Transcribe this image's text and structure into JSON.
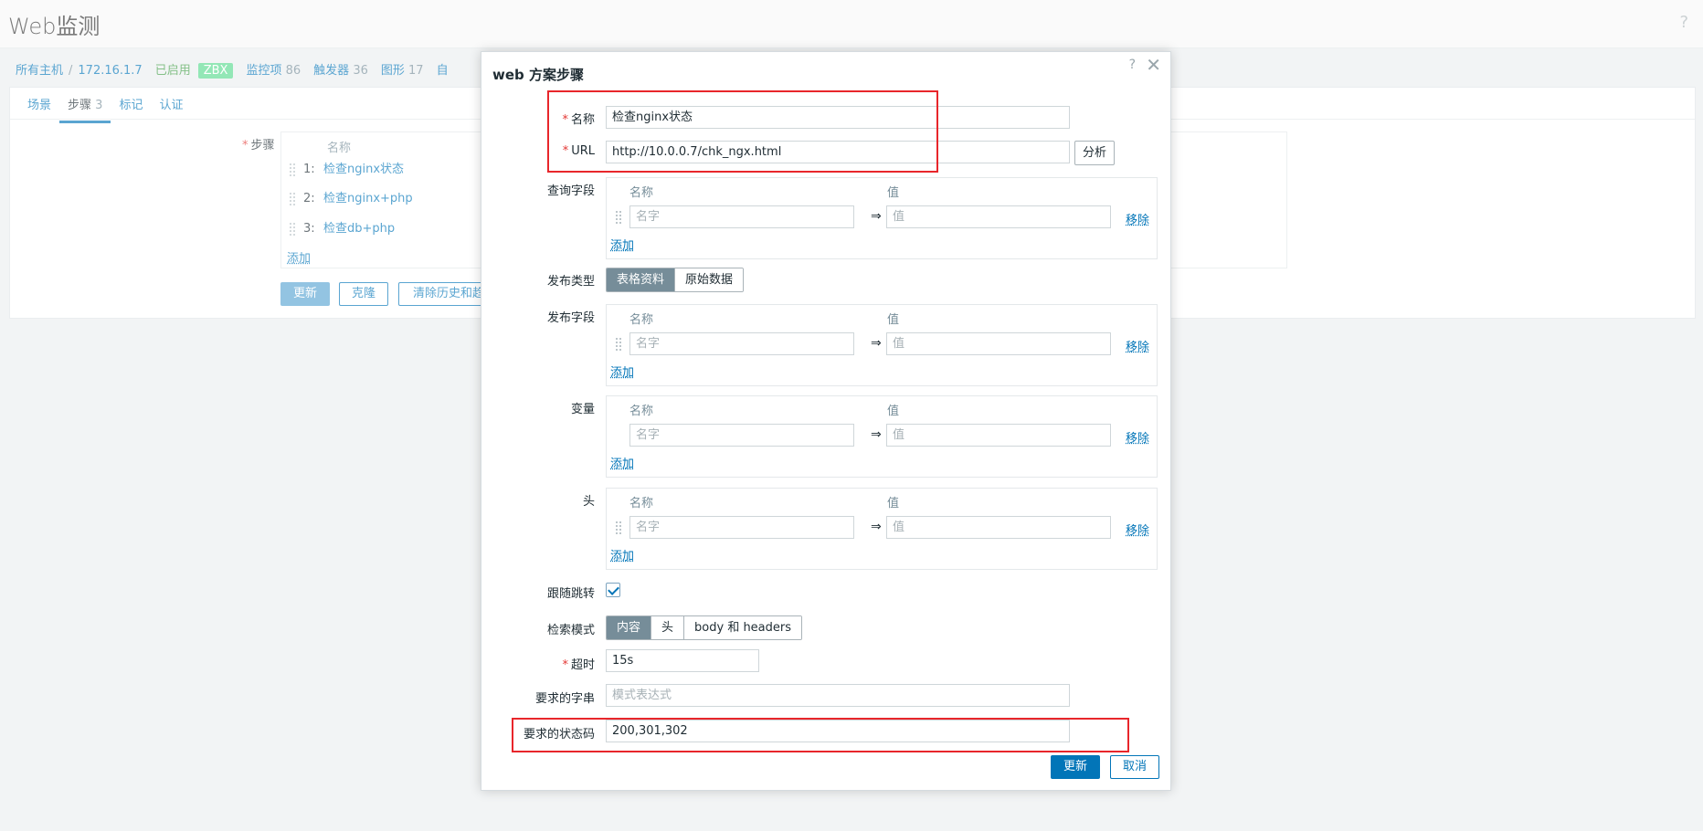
{
  "page": {
    "title": "Web监测",
    "help": "?"
  },
  "breadcrumb": {
    "all_hosts": "所有主机",
    "separator": "/",
    "host": "172.16.1.7",
    "status": "已启用",
    "zbx": "ZBX",
    "items_label": "监控项",
    "items_count": "86",
    "triggers_label": "触发器",
    "triggers_count": "36",
    "graphs_label": "图形",
    "graphs_count": "17",
    "more": "自"
  },
  "tabs": [
    {
      "label": "场景",
      "count": ""
    },
    {
      "label": "步骤",
      "count": "3"
    },
    {
      "label": "标记",
      "count": ""
    },
    {
      "label": "认证",
      "count": ""
    }
  ],
  "steps": {
    "label": "步骤",
    "name_header": "名称",
    "items": [
      {
        "num": "1:",
        "name": "检查nginx状态"
      },
      {
        "num": "2:",
        "name": "检查nginx+php"
      },
      {
        "num": "3:",
        "name": "检查db+php"
      }
    ],
    "add": "添加"
  },
  "main_buttons": {
    "update": "更新",
    "clone": "克隆",
    "clear": "清除历史和趋"
  },
  "dialog": {
    "title": "web 方案步骤",
    "help": "?",
    "close": "✕",
    "name_label": "名称",
    "name_value": "检查nginx状态",
    "url_label": "URL",
    "url_value": "http://10.0.0.7/chk_ngx.html",
    "parse_button": "分析",
    "query_label": "查询字段",
    "post_type_label": "发布类型",
    "post_type_options": [
      "表格资料",
      "原始数据"
    ],
    "post_fields_label": "发布字段",
    "variables_label": "变量",
    "headers_label": "头",
    "col_name": "名称",
    "col_value": "值",
    "name_placeholder": "名字",
    "value_placeholder": "值",
    "arrow": "⇒",
    "remove": "移除",
    "add": "添加",
    "follow_label": "跟随跳转",
    "retrieve_label": "检索模式",
    "retrieve_options": [
      "内容",
      "头",
      "body 和 headers"
    ],
    "timeout_label": "超时",
    "timeout_value": "15s",
    "required_string_label": "要求的字串",
    "required_string_placeholder": "模式表达式",
    "status_codes_label": "要求的状态码",
    "status_codes_value": "200,301,302",
    "update_button": "更新",
    "cancel_button": "取消"
  }
}
